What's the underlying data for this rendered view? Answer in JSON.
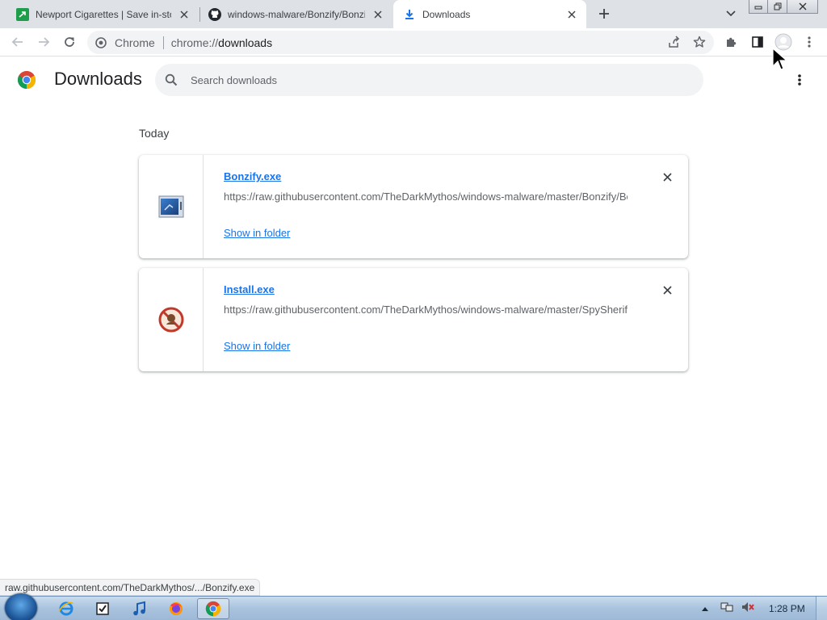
{
  "tabs": [
    {
      "title": "Newport Cigarettes | Save in-stock",
      "favicon": "newport-favicon",
      "active": false
    },
    {
      "title": "windows-malware/Bonzify/Bonzify",
      "favicon": "github-icon",
      "active": false
    },
    {
      "title": "Downloads",
      "favicon": "download-icon",
      "active": true
    }
  ],
  "omnibox": {
    "chip": "Chrome",
    "scheme": "chrome://",
    "path": "downloads"
  },
  "page": {
    "title": "Downloads",
    "search_placeholder": "Search downloads",
    "section_date": "Today"
  },
  "downloads": [
    {
      "filename": "Bonzify.exe",
      "url": "https://raw.githubusercontent.com/TheDarkMythos/windows-malware/master/Bonzify/Bonzify.exe",
      "action": "Show in folder",
      "icon": "exe-window-icon"
    },
    {
      "filename": "Install.exe",
      "url": "https://raw.githubusercontent.com/TheDarkMythos/windows-malware/master/SpySheriff/Install.exe",
      "action": "Show in folder",
      "icon": "spysheriff-icon"
    }
  ],
  "status_url": "raw.githubusercontent.com/TheDarkMythos/.../Bonzify.exe",
  "taskbar": {
    "clock": "1:28 PM",
    "apps": [
      "internet-explorer-icon",
      "tasks-icon",
      "itunes-icon",
      "firefox-icon",
      "chrome-icon"
    ]
  },
  "colors": {
    "link": "#1a73e8",
    "tabstrip": "#dee1e6",
    "omnibox": "#f1f3f4"
  }
}
